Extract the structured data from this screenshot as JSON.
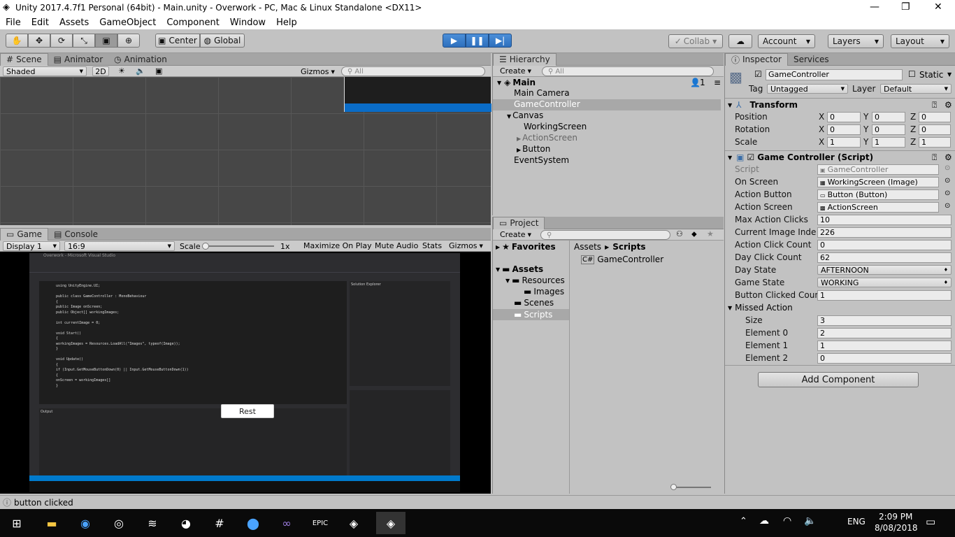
{
  "window": {
    "title": "Unity 2017.4.7f1 Personal (64bit) - Main.unity - Overwork - PC, Mac & Linux Standalone <DX11>",
    "min": "—",
    "restore": "❐",
    "close": "✕"
  },
  "menu": [
    "File",
    "Edit",
    "Assets",
    "GameObject",
    "Component",
    "Window",
    "Help"
  ],
  "toolbar": {
    "tools": [
      "hand-tool-icon",
      "move-tool-icon",
      "rotate-tool-icon",
      "scale-tool-icon",
      "rect-tool-icon",
      "transform-tool-icon"
    ],
    "pivot": "Center",
    "space": "Global",
    "collab": "Collab",
    "account": "Account",
    "layers": "Layers",
    "layout": "Layout"
  },
  "scene": {
    "tabs": [
      "Scene",
      "Animator",
      "Animation"
    ],
    "shading": "Shaded",
    "mode2d": "2D",
    "gizmos": "Gizmos",
    "search_placeholder": "All"
  },
  "game": {
    "tabs": [
      "Game",
      "Console"
    ],
    "display": "Display 1",
    "aspect": "16:9",
    "scale_label": "Scale",
    "scale_value": "1x",
    "maximize": "Maximize On Play",
    "mute": "Mute Audio",
    "stats": "Stats",
    "gizmos": "Gizmos",
    "button_label": "Rest",
    "vs_title": "Overwork - Microsoft Visual Studio",
    "vs_code": [
      "using UnityEngine.UI;",
      "",
      "public class GameController : MonoBehaviour",
      "{",
      "    public Image onScreen;",
      "    public Object[] workingImages;",
      "",
      "    int currentImage = 0;",
      "",
      "    void Start()",
      "    {",
      "        workingImages = Resources.LoadAll(\"Images\", typeof(Image));",
      "    }",
      "",
      "    void Update()",
      "    {",
      "        if (Input.GetMouseButtonDown(0) || Input.GetMouseButtonDown(1))",
      "        {",
      "            onScreen = workingImages[]",
      "        }"
    ],
    "vs_output": "Output",
    "vs_solution": "Solution Explorer"
  },
  "hierarchy": {
    "tab": "Hierarchy",
    "create": "Create",
    "search_placeholder": "All",
    "scene_name": "Main",
    "users": "1",
    "items": [
      {
        "label": "Main Camera",
        "indent": 0
      },
      {
        "label": "GameController",
        "indent": 0
      },
      {
        "label": "Canvas",
        "indent": 0
      },
      {
        "label": "WorkingScreen",
        "indent": 1
      },
      {
        "label": "ActionScreen",
        "indent": 1
      },
      {
        "label": "Button",
        "indent": 1
      },
      {
        "label": "EventSystem",
        "indent": 0
      }
    ]
  },
  "project": {
    "tab": "Project",
    "create": "Create",
    "favorites": "Favorites",
    "assets": "Assets",
    "resources": "Resources",
    "images": "Images",
    "scenes": "Scenes",
    "scripts": "Scripts",
    "breadcrumb": [
      "Assets",
      "Scripts"
    ],
    "file": "GameController"
  },
  "inspector": {
    "tabs": [
      "Inspector",
      "Services"
    ],
    "object_name": "GameController",
    "static": "Static",
    "tag_label": "Tag",
    "tag": "Untagged",
    "layer_label": "Layer",
    "layer": "Default",
    "transform": {
      "title": "Transform",
      "rows": [
        {
          "label": "Position",
          "x": "0",
          "y": "0",
          "z": "0"
        },
        {
          "label": "Rotation",
          "x": "0",
          "y": "0",
          "z": "0"
        },
        {
          "label": "Scale",
          "x": "1",
          "y": "1",
          "z": "1"
        }
      ]
    },
    "script": {
      "title": "Game Controller (Script)",
      "fields": [
        {
          "label": "Script",
          "value": "GameController"
        },
        {
          "label": "On Screen",
          "value": "WorkingScreen (Image)"
        },
        {
          "label": "Action Button",
          "value": "Button (Button)"
        },
        {
          "label": "Action Screen",
          "value": "ActionScreen"
        },
        {
          "label": "Max Action Clicks",
          "value": "10"
        },
        {
          "label": "Current Image Inde",
          "value": "226"
        },
        {
          "label": "Action Click Count",
          "value": "0"
        },
        {
          "label": "Day Click Count",
          "value": "62"
        },
        {
          "label": "Day State",
          "value": "AFTERNOON"
        },
        {
          "label": "Game State",
          "value": "WORKING"
        },
        {
          "label": "Button Clicked Coun",
          "value": "1"
        }
      ],
      "missed_action": "Missed Action",
      "array": [
        {
          "label": "Size",
          "value": "3"
        },
        {
          "label": "Element 0",
          "value": "2"
        },
        {
          "label": "Element 1",
          "value": "1"
        },
        {
          "label": "Element 2",
          "value": "0"
        }
      ]
    },
    "add_component": "Add Component"
  },
  "status": {
    "message": "button clicked"
  },
  "taskbar": {
    "time": "2:09 PM",
    "date": "8/08/2018",
    "lang": "ENG"
  }
}
